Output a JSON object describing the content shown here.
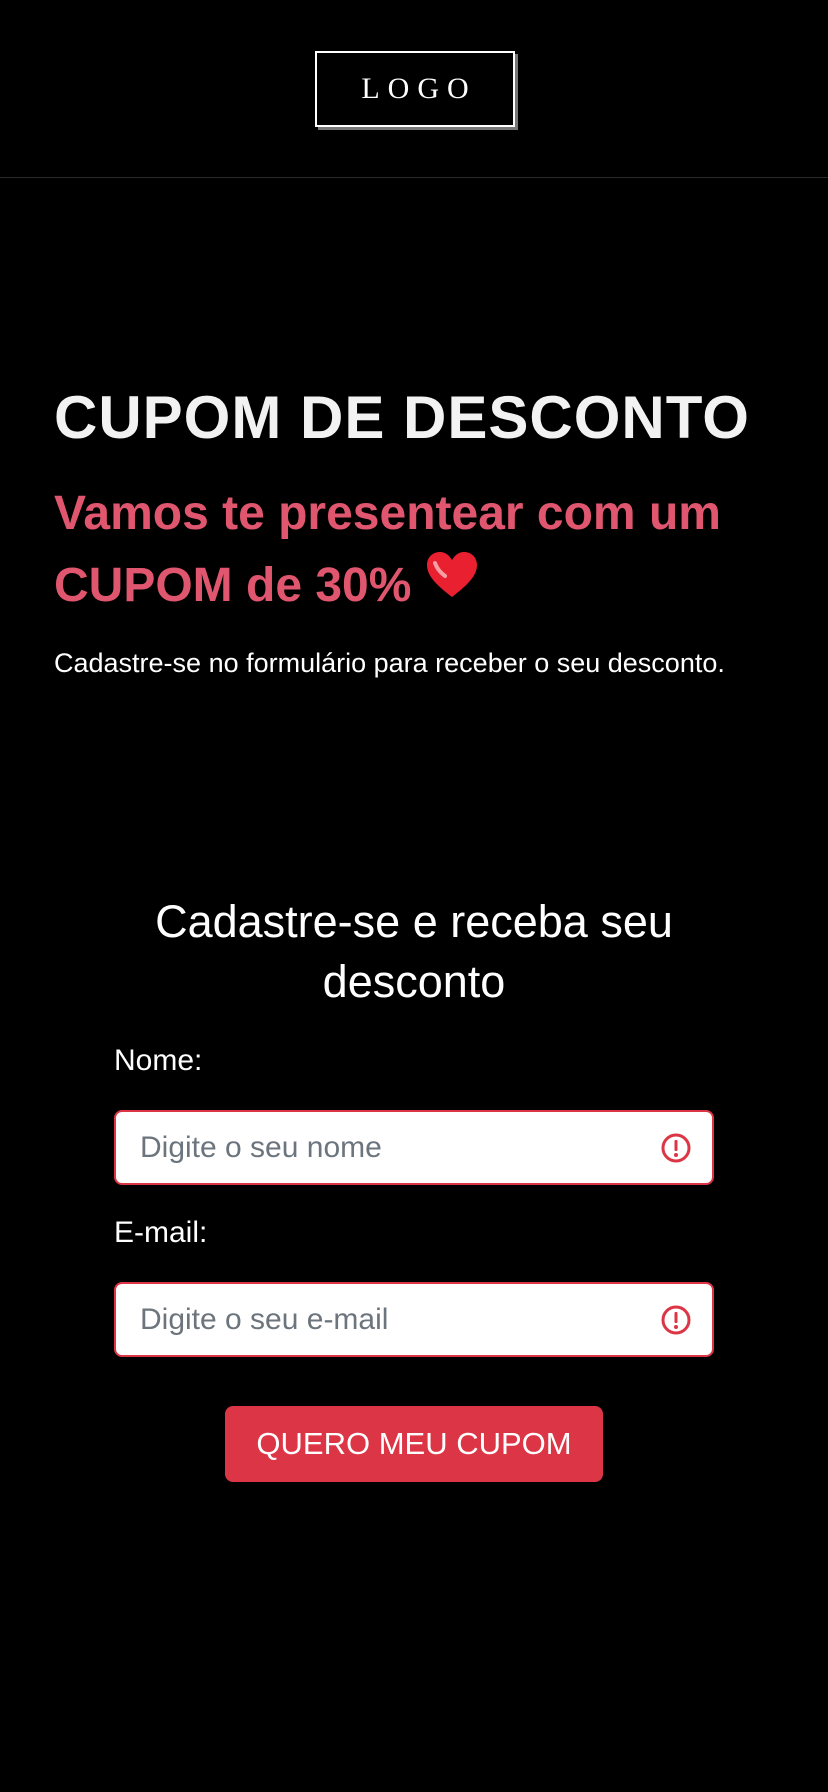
{
  "header": {
    "logo_text": "LOGO"
  },
  "hero": {
    "title": "CUPOM DE DESCONTO",
    "subtitle": "Vamos te presentear com um CUPOM de 30%",
    "subtitle_icon": "heart-icon",
    "description": "Cadastre-se no formulário para receber o seu desconto."
  },
  "form": {
    "title": "Cadastre-se e receba seu desconto",
    "name_label": "Nome:",
    "name_placeholder": "Digite o seu nome",
    "name_value": "",
    "email_label": "E-mail:",
    "email_placeholder": "Digite o seu e-mail",
    "email_value": "",
    "validation_icon": "alert-circle-icon",
    "submit_label": "QUERO MEU CUPOM"
  },
  "colors": {
    "background": "#000000",
    "accent_pink": "#e0566e",
    "button_red": "#dc3545",
    "heart_red": "#e8202f"
  }
}
